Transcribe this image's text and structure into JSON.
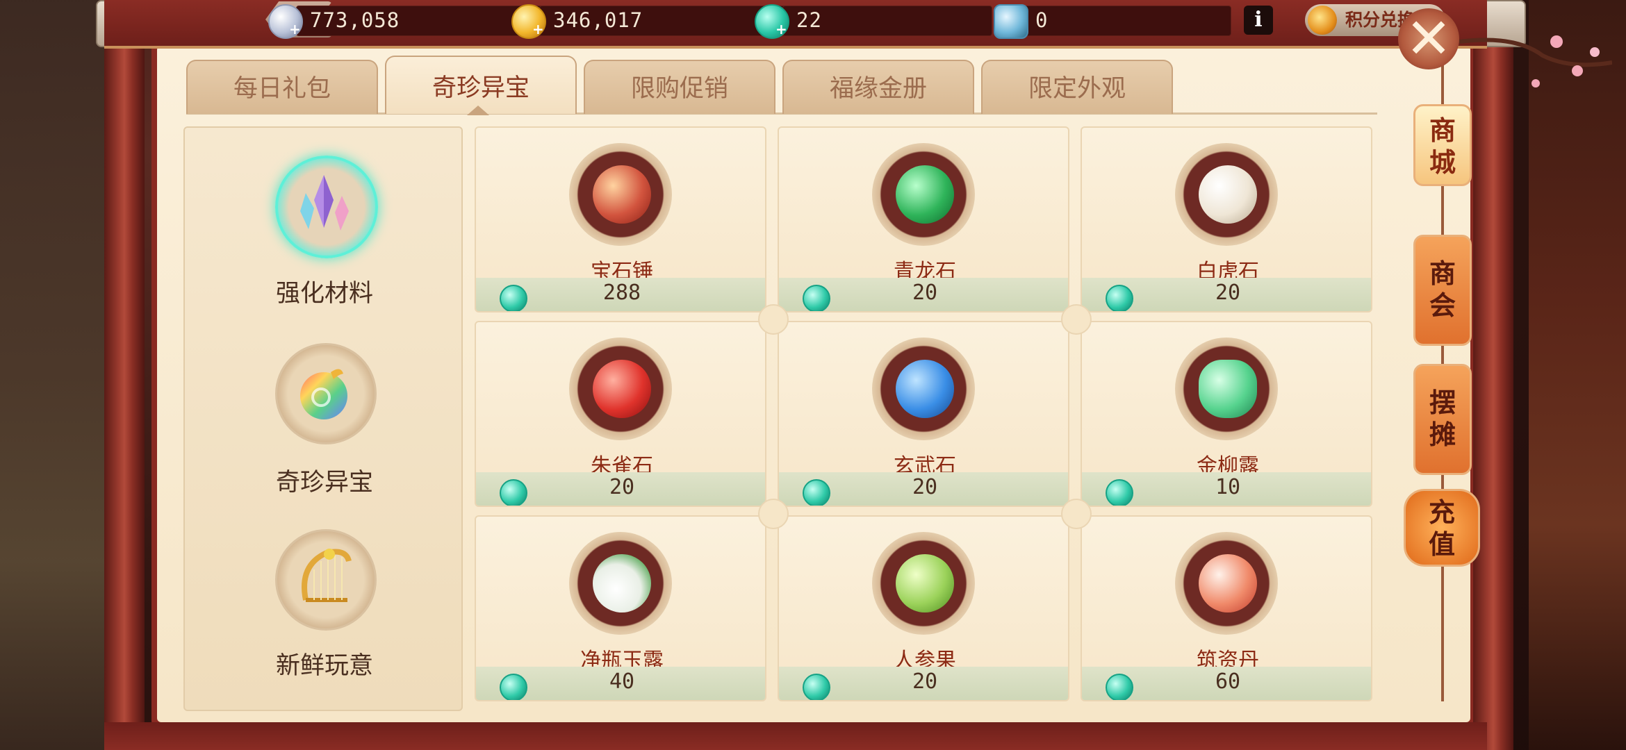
{
  "currencies": [
    {
      "name": "silver",
      "icon": "silver-coin-icon",
      "value": "773,058"
    },
    {
      "name": "gold",
      "icon": "gold-coin-icon",
      "value": "346,017"
    },
    {
      "name": "jade",
      "icon": "jade-token-icon",
      "value": "22"
    },
    {
      "name": "bag",
      "icon": "bag-token-icon",
      "value": "0"
    }
  ],
  "info_label": "i",
  "points_exchange_label": "积分兑换",
  "close_label": "✕",
  "tabs": [
    {
      "label": "每日礼包",
      "active": false
    },
    {
      "label": "奇珍异宝",
      "active": true
    },
    {
      "label": "限购促销",
      "active": false
    },
    {
      "label": "福缘金册",
      "active": false
    },
    {
      "label": "限定外观",
      "active": false
    }
  ],
  "categories": [
    {
      "label": "强化材料",
      "icon": "crystal-icon",
      "active": true
    },
    {
      "label": "奇珍异宝",
      "icon": "rainbow-pouch-icon",
      "active": false
    },
    {
      "label": "新鲜玩意",
      "icon": "harp-icon",
      "active": false
    }
  ],
  "items": [
    {
      "name": "宝石锤",
      "price": "288",
      "icon": "hammer-icon",
      "color": "#d2543e"
    },
    {
      "name": "青龙石",
      "price": "20",
      "icon": "green-dragon-stone-icon",
      "color": "#2fb45a"
    },
    {
      "name": "白虎石",
      "price": "20",
      "icon": "white-tiger-stone-icon",
      "color": "#efe6d6"
    },
    {
      "name": "朱雀石",
      "price": "20",
      "icon": "vermilion-bird-stone-icon",
      "color": "#e0332c"
    },
    {
      "name": "玄武石",
      "price": "20",
      "icon": "black-tortoise-stone-icon",
      "color": "#3a8ee6"
    },
    {
      "name": "金柳露",
      "price": "10",
      "icon": "willow-dew-bottle-icon",
      "color": "#56d38e"
    },
    {
      "name": "净瓶玉露",
      "price": "40",
      "icon": "jade-vase-icon",
      "color": "#e9efe6"
    },
    {
      "name": "人参果",
      "price": "20",
      "icon": "ginseng-fruit-icon",
      "color": "#9bd25a"
    },
    {
      "name": "筑资丹",
      "price": "60",
      "icon": "pill-icon",
      "color": "#f08a6a"
    }
  ],
  "price_currency_icon": "jade-token-icon",
  "side_buttons": [
    {
      "label": "商城",
      "active": true
    },
    {
      "label": "商会",
      "active": false
    },
    {
      "label": "摆摊",
      "active": false
    },
    {
      "label": "充值",
      "active": false
    }
  ]
}
